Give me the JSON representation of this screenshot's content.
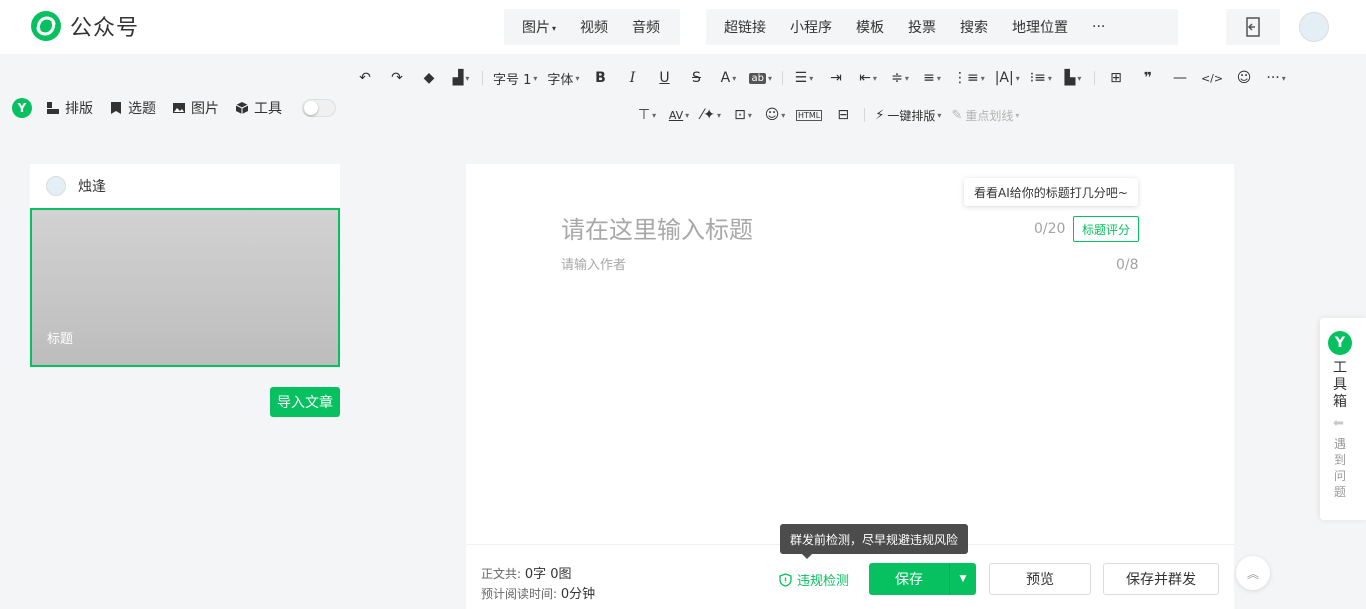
{
  "brand": {
    "name": "公众号",
    "accent": "#07c160"
  },
  "nav": {
    "group1": [
      {
        "label": "图片",
        "caret": "▾"
      },
      {
        "label": "视频"
      },
      {
        "label": "音频"
      }
    ],
    "group2": [
      {
        "label": "超链接"
      },
      {
        "label": "小程序"
      },
      {
        "label": "模板"
      },
      {
        "label": "投票"
      },
      {
        "label": "搜索"
      },
      {
        "label": "地理位置"
      },
      {
        "label": "···"
      }
    ]
  },
  "toolbar": {
    "font_size": "字号 1",
    "font_family": "字体",
    "bold": "B",
    "italic": "I",
    "underline": "U",
    "strike": "S",
    "font_color": "A",
    "highlight": "ab",
    "quote": "❞",
    "code": "</>",
    "more": "···",
    "one_click": "一键排版",
    "keypoint": "重点划线",
    "html": "HTML"
  },
  "left_tools": {
    "badge": "Y",
    "items": [
      "排版",
      "选题",
      "图片",
      "工具"
    ]
  },
  "article_list": {
    "account_name": "烛逢",
    "cover_title": "标题",
    "import_label": "导入文章"
  },
  "editor": {
    "ai_tip": "看看AI给你的标题打几分吧~",
    "title_placeholder": "请在这里输入标题",
    "title_count": "0/20",
    "score_label": "标题评分",
    "author_placeholder": "请输入作者",
    "author_count": "0/8"
  },
  "footer": {
    "word_label": "正文共:",
    "word_value": "0字 0图",
    "read_label": "预计阅读时间:",
    "read_value": "0分钟",
    "check_label": "违规检测",
    "save_label": "保存",
    "preview_label": "预览",
    "publish_label": "保存并群发",
    "tooltip": "群发前检测，尽早规避违规风险"
  },
  "toolbox": {
    "badge": "Y",
    "label": "工具箱",
    "help": "遇到问题"
  }
}
